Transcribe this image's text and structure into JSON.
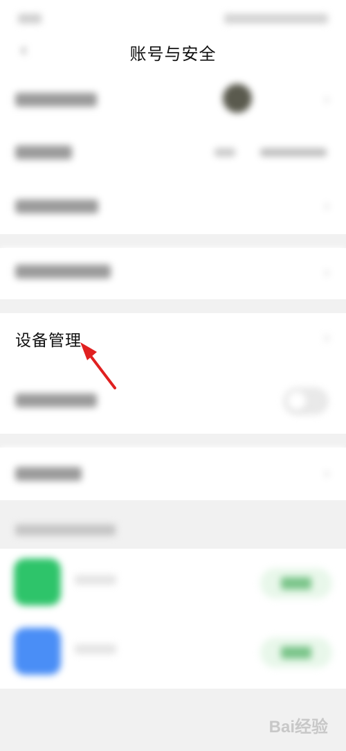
{
  "header": {
    "title": "账号与安全",
    "back_icon": "chevron-left-icon"
  },
  "rows": {
    "device_management": {
      "label": "设备管理"
    }
  },
  "colors": {
    "arrow": "#e02020",
    "wechat_green": "#2ec46a",
    "blue_app": "#4a8ef6"
  },
  "annotation": {
    "arrow_icon": "red-arrow-icon"
  },
  "watermark": {
    "text": "Bai经验"
  }
}
